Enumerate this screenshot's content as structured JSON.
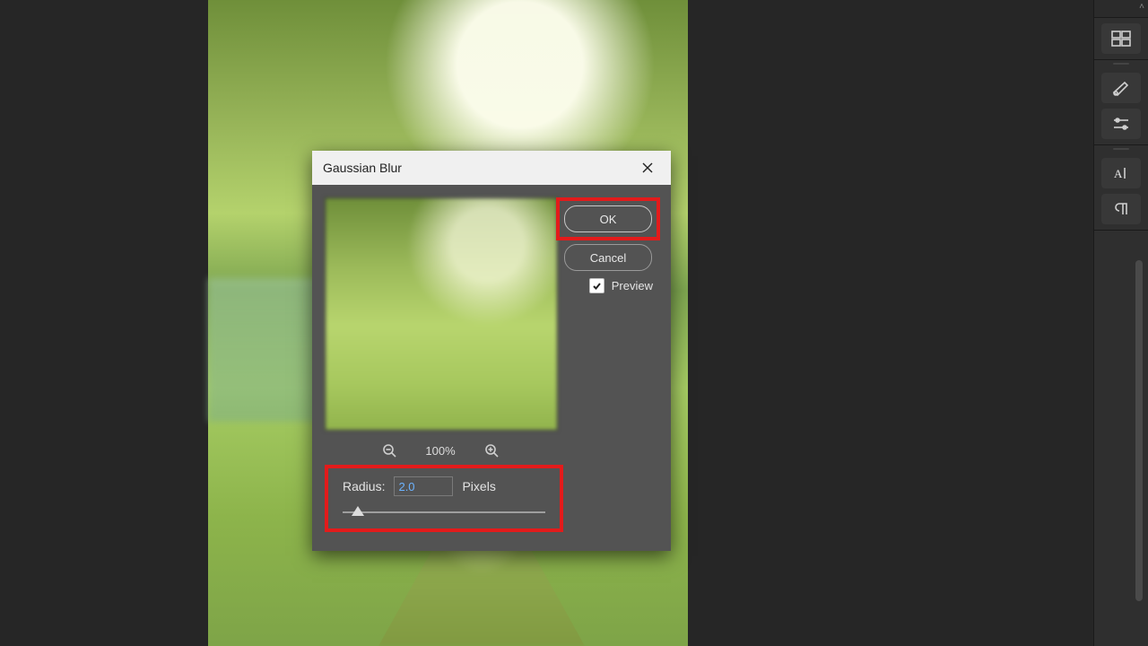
{
  "dialog": {
    "title": "Gaussian Blur",
    "ok_label": "OK",
    "cancel_label": "Cancel",
    "preview_label": "Preview",
    "preview_checked": true,
    "zoom_value": "100%",
    "radius_label": "Radius:",
    "radius_value": "2.0",
    "radius_unit": "Pixels"
  }
}
